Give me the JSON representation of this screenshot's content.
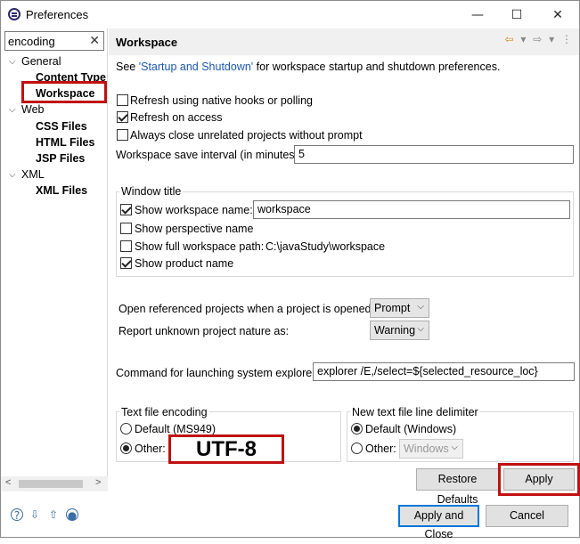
{
  "window": {
    "title": "Preferences",
    "minimize": "—",
    "maximize": "☐",
    "close": "✕"
  },
  "filter": {
    "value": "encoding",
    "clear": "✕"
  },
  "tree": [
    {
      "label": "General",
      "arrow": "⌵"
    },
    {
      "label": "Content Type"
    },
    {
      "label": "Workspace"
    },
    {
      "label": "Web",
      "arrow": "⌵"
    },
    {
      "label": "CSS Files"
    },
    {
      "label": "HTML Files"
    },
    {
      "label": "JSP Files"
    },
    {
      "label": "XML",
      "arrow": "⌵"
    },
    {
      "label": "XML Files"
    }
  ],
  "page": {
    "title": "Workspace",
    "desc_pre": "See ",
    "desc_link": "'Startup and Shutdown'",
    "desc_post": " for workspace startup and shutdown preferences.",
    "refresh_native": {
      "label": "Refresh using native hooks or polling",
      "checked": false
    },
    "refresh_access": {
      "label": "Refresh on access",
      "checked": true
    },
    "always_close": {
      "label": "Always close unrelated projects without prompt",
      "checked": false
    },
    "save_interval": {
      "label": "Workspace save interval (in minutes):",
      "value": "5"
    },
    "window_title": {
      "group_label": "Window title",
      "show_name": {
        "label": "Show workspace name:",
        "checked": true,
        "value": "workspace"
      },
      "show_perspective": {
        "label": "Show perspective name",
        "checked": false
      },
      "show_full_path": {
        "label": "Show full workspace path:",
        "checked": false,
        "path": "C:\\javaStudy\\workspace"
      },
      "show_product": {
        "label": "Show product name",
        "checked": true
      }
    },
    "open_referenced": {
      "label": "Open referenced projects when a project is opened:",
      "value": "Prompt"
    },
    "report_unknown": {
      "label": "Report unknown project nature as:",
      "value": "Warning"
    },
    "explorer_cmd": {
      "label": "Command for launching system explorer:",
      "value": "explorer /E,/select=${selected_resource_loc}"
    },
    "encoding": {
      "group_label": "Text file encoding",
      "default_label": "Default (MS949)",
      "other_label": "Other:",
      "other_value": "UTF-8",
      "selected": "other"
    },
    "line_delim": {
      "group_label": "New text file line delimiter",
      "default_label": "Default (Windows)",
      "other_label": "Other:",
      "other_value": "Windows",
      "selected": "default"
    },
    "restore_defaults": "Restore Defaults",
    "apply": "Apply"
  },
  "footer": {
    "apply_close": "Apply and Close",
    "cancel": "Cancel"
  },
  "icons": [
    "help-icon",
    "import-icon",
    "export-icon",
    "record-icon"
  ]
}
